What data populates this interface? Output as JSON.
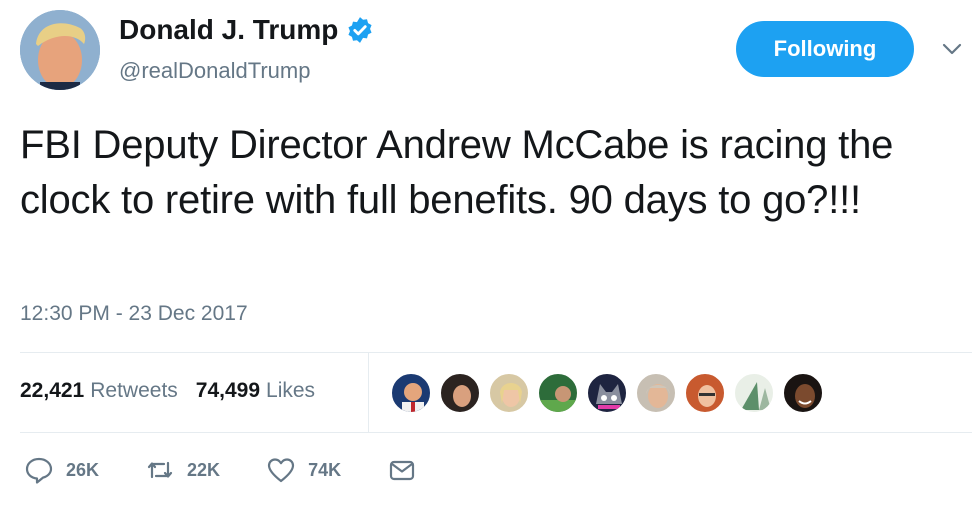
{
  "user": {
    "display_name": "Donald J. Trump",
    "handle": "@realDonaldTrump",
    "verified_icon": "verified-badge-icon"
  },
  "follow_button": {
    "label": "Following"
  },
  "tweet": {
    "text": "FBI Deputy Director Andrew McCabe is racing the clock to retire with full benefits. 90 days to go?!!!",
    "timestamp": "12:30 PM - 23 Dec 2017"
  },
  "stats": {
    "retweets_count": "22,421",
    "retweets_label": "Retweets",
    "likes_count": "74,499",
    "likes_label": "Likes"
  },
  "liker_avatars": 9,
  "actions": {
    "reply_count": "26K",
    "retweet_count": "22K",
    "like_count": "74K"
  },
  "colors": {
    "accent": "#1da1f2",
    "secondary_text": "#657786",
    "primary_text": "#14171a"
  }
}
